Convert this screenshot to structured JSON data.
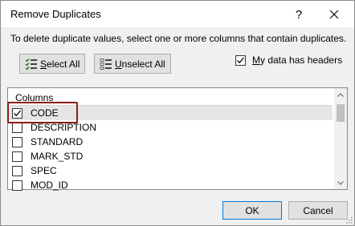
{
  "window": {
    "title": "Remove Duplicates",
    "help_symbol": "?"
  },
  "instructions": "To delete duplicate values, select one or more columns that contain duplicates.",
  "buttons": {
    "select_all_mnemonic": "S",
    "select_all_rest": "elect All",
    "unselect_all_mnemonic": "U",
    "unselect_all_rest": "nselect All",
    "ok": "OK",
    "cancel": "Cancel"
  },
  "headers_checkbox": {
    "mnemonic": "M",
    "rest": "y data has headers",
    "checked": true
  },
  "columns": {
    "header": "Columns",
    "items": [
      {
        "label": "CODE",
        "checked": true,
        "selected": true
      },
      {
        "label": "DESCRIPTION",
        "checked": false,
        "selected": false
      },
      {
        "label": "STANDARD",
        "checked": false,
        "selected": false
      },
      {
        "label": "MARK_STD",
        "checked": false,
        "selected": false
      },
      {
        "label": "SPEC",
        "checked": false,
        "selected": false
      },
      {
        "label": "MOD_ID",
        "checked": false,
        "selected": false
      }
    ]
  },
  "colors": {
    "highlight_border": "#8b1a1a",
    "ok_border": "#0078d7"
  }
}
